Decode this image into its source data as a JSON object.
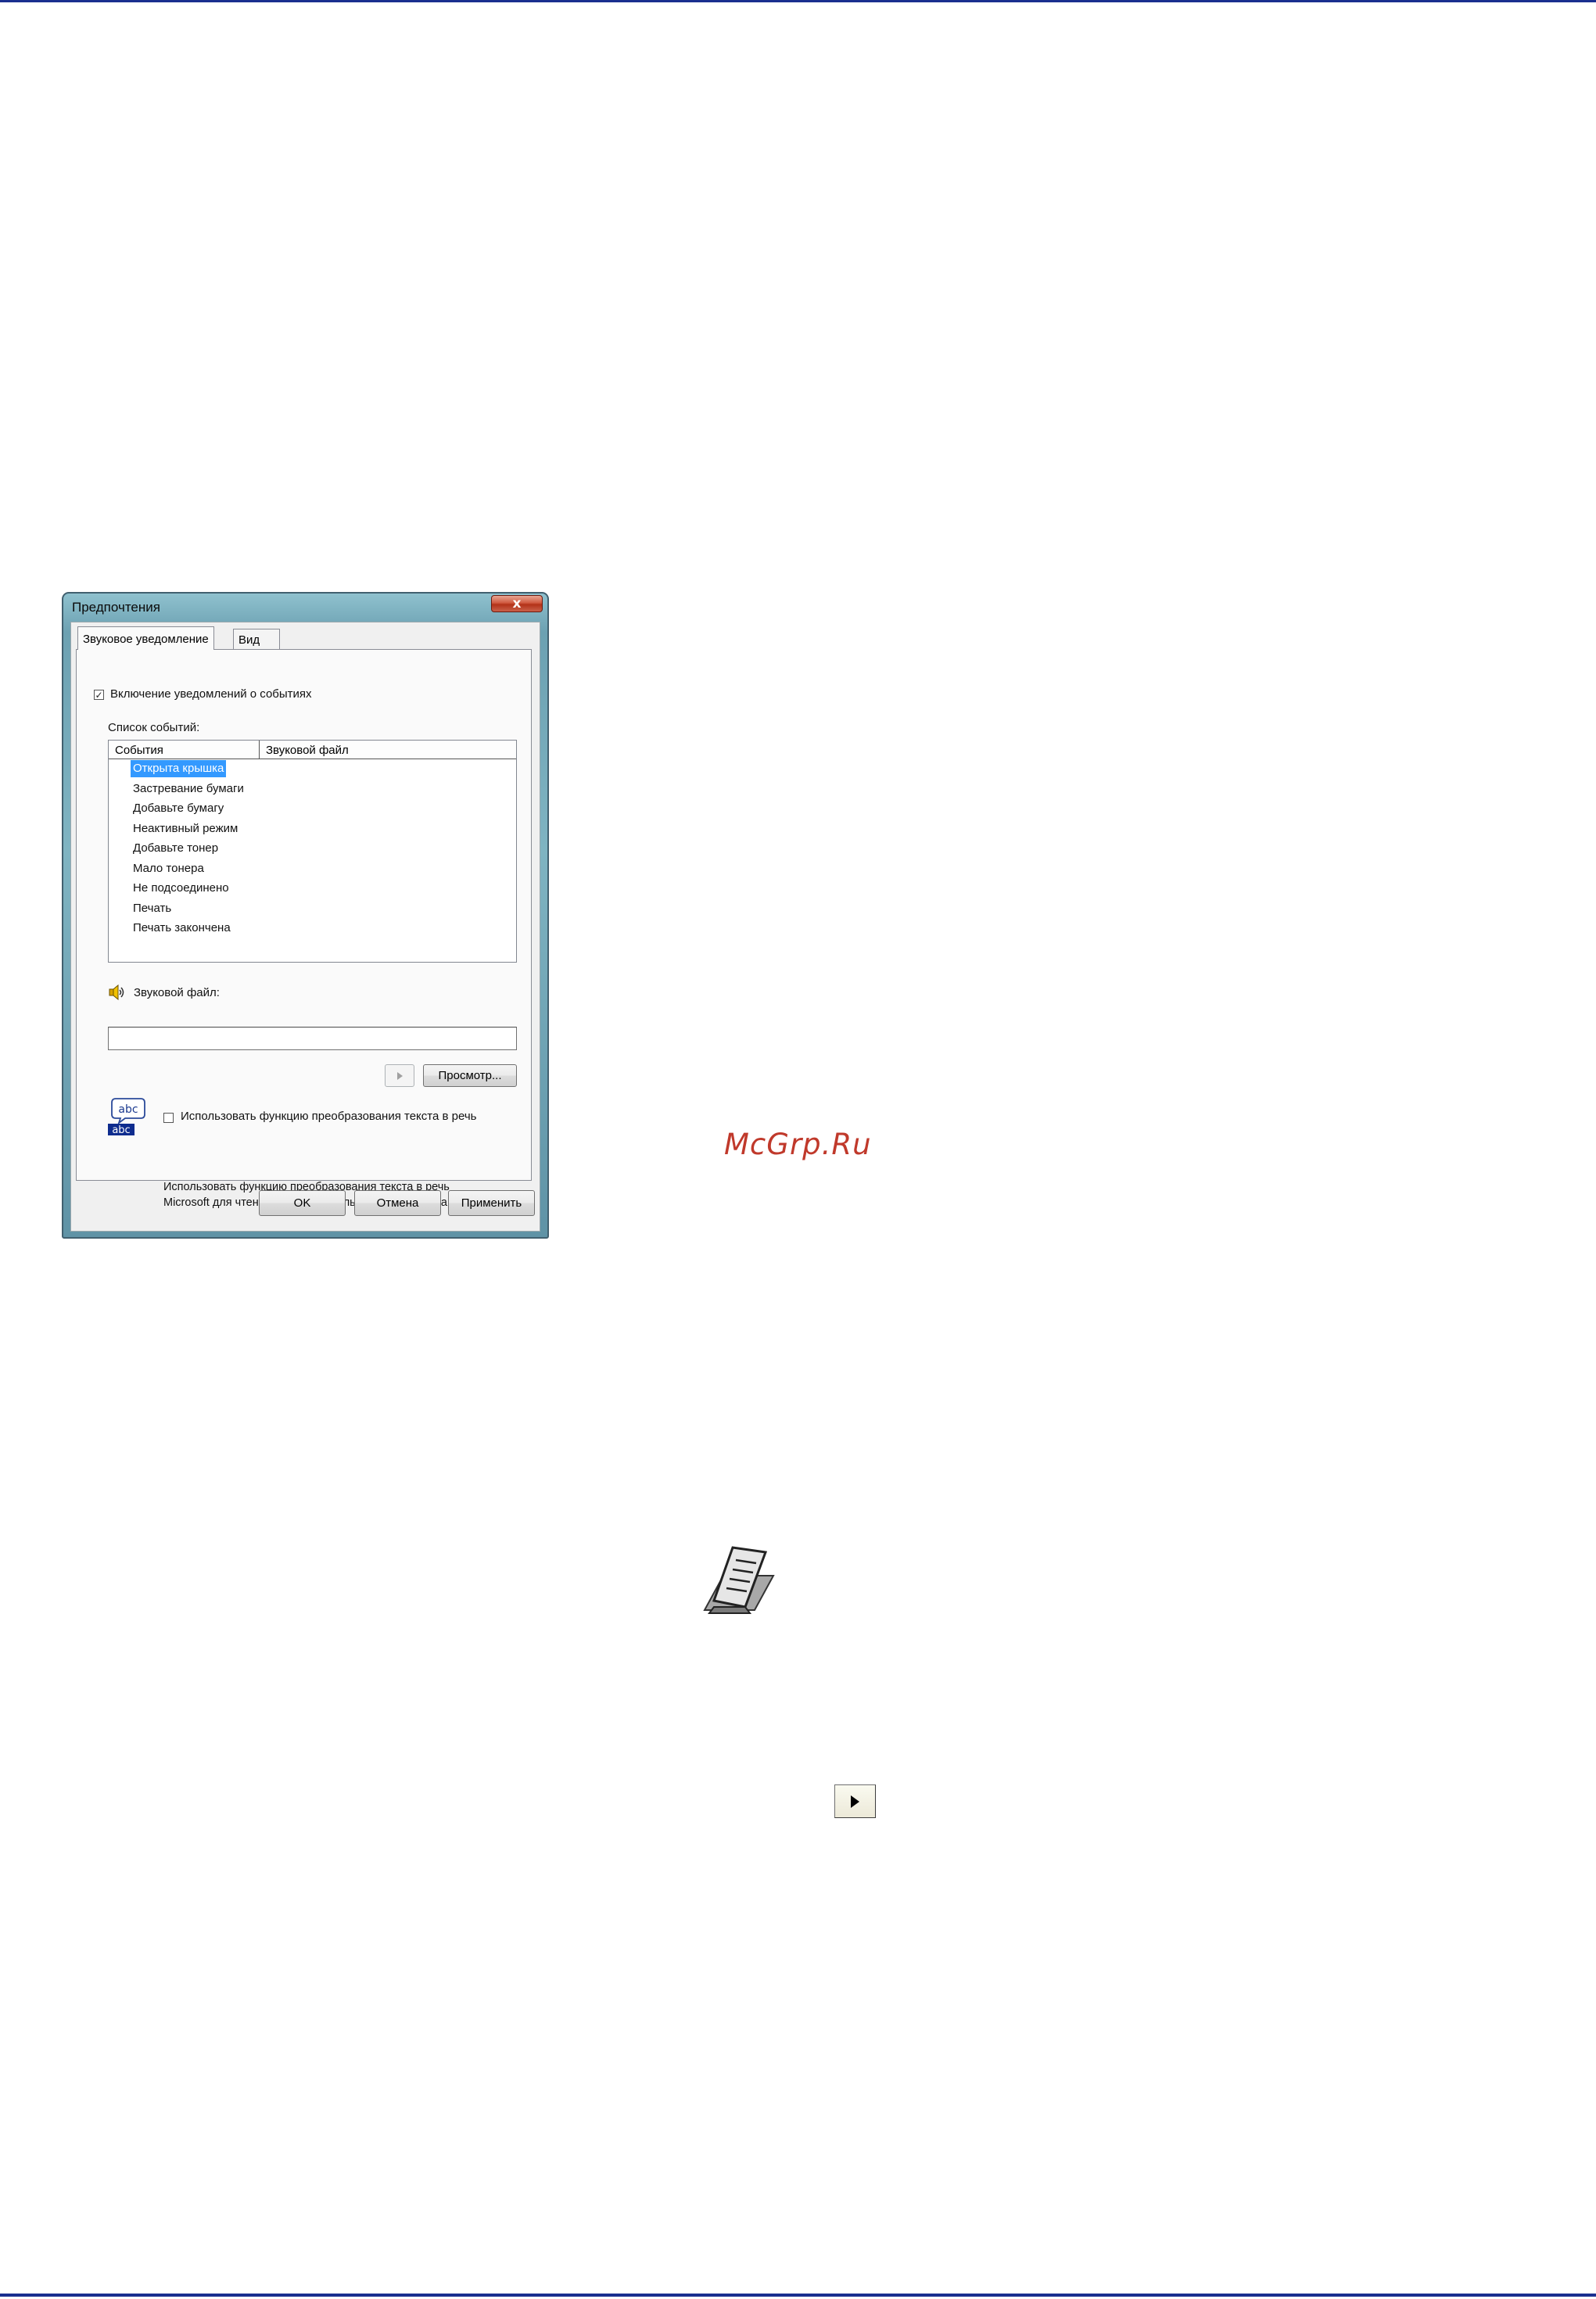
{
  "dialog": {
    "title": "Предпочтения",
    "close_label": "x",
    "tabs": [
      {
        "label": "Звуковое уведомление",
        "active": true
      },
      {
        "label": "Вид",
        "active": false
      }
    ],
    "enable_events": {
      "label": "Включение уведомлений о событиях",
      "checked": true,
      "check_glyph": "✓"
    },
    "event_list_label": "Список событий:",
    "columns": [
      "События",
      "Звуковой файл"
    ],
    "events": [
      "Открыта крышка",
      "Застревание бумаги",
      "Добавьте бумагу",
      "Неактивный режим",
      "Добавьте тонер",
      "Мало тонера",
      "Не подсоединено",
      "Печать",
      "Печать закончена"
    ],
    "selected_event_index": 0,
    "sound_file_label": "Звуковой файл:",
    "sound_file_value": "",
    "browse_button": "Просмотр...",
    "tts_icon_text": "abc",
    "tts_checkbox": {
      "label": "Использовать функцию преобразования текста в речь",
      "checked": false
    },
    "tts_help_line1": "Использовать функцию преобразования текста в речь",
    "tts_help_line2": "Microsoft для чтения заданного пользователем текста.",
    "buttons": {
      "ok": "OK",
      "cancel": "Отмена",
      "apply": "Применить"
    }
  },
  "watermark": "McGrp.Ru",
  "colors": {
    "rule": "#1a2f8f",
    "selection": "#3399ff",
    "watermark": "#c0392b"
  },
  "icons": [
    "speaker-icon",
    "text-to-speech-icon",
    "note-icon",
    "play-icon"
  ]
}
